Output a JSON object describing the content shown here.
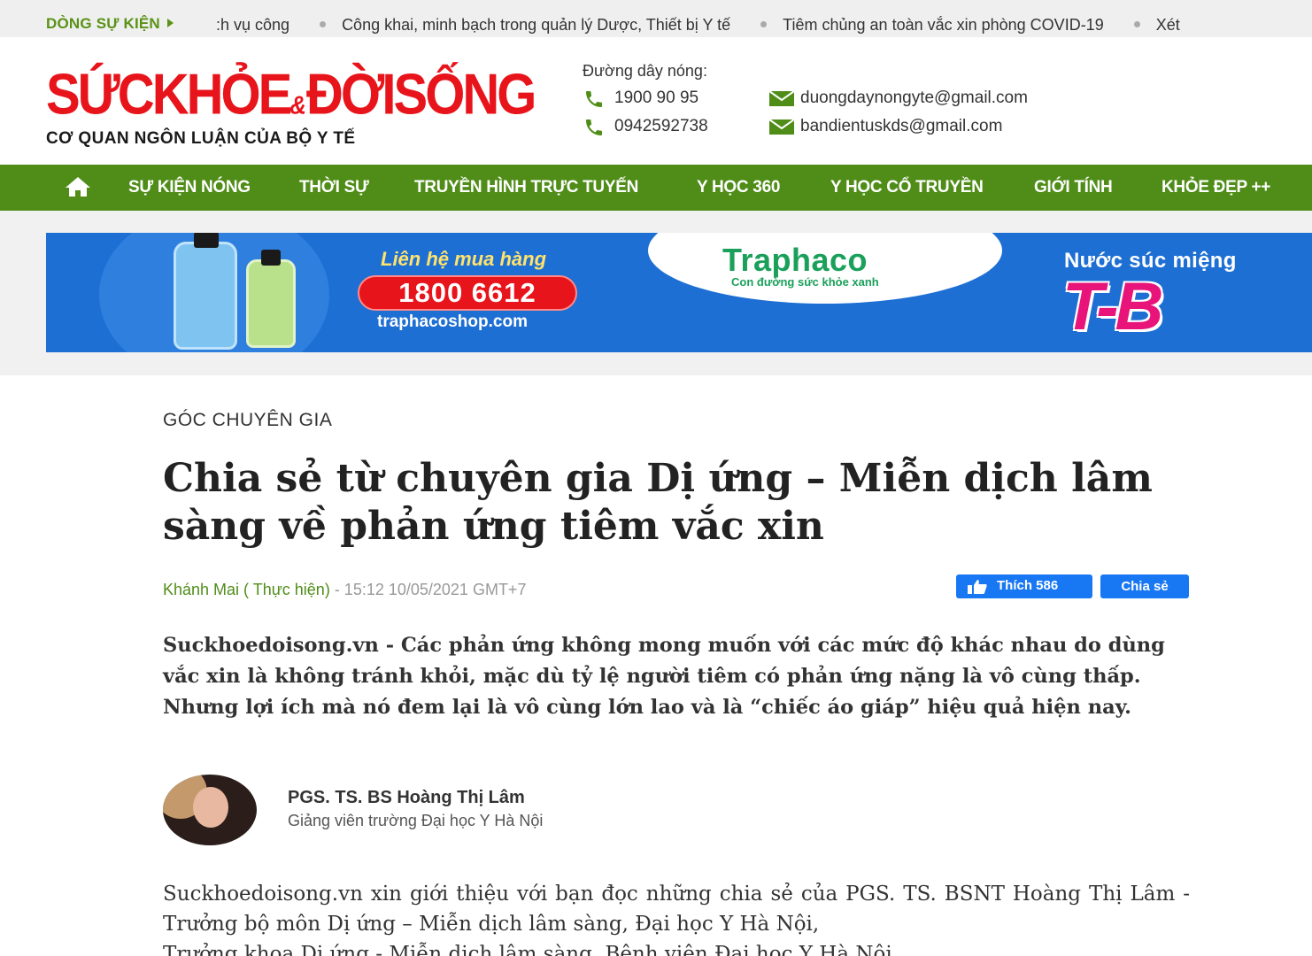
{
  "ticker": {
    "label": "DÒNG SỰ KIỆN",
    "items": [
      ":h vụ công",
      "Công khai, minh bạch trong quản lý Dược, Thiết bị Y tế",
      "Tiêm chủng an toàn vắc xin phòng COVID-19",
      "Xét"
    ]
  },
  "header": {
    "logo_main": "SỨCKHỎE",
    "logo_amp": "&",
    "logo_main2": "ĐỜISỐNG",
    "logo_sub": "CƠ QUAN NGÔN LUẬN CỦA BỘ Y TẾ",
    "hotline_title": "Đường dây nóng:",
    "phone1": "1900 90 95",
    "phone2": "0942592738",
    "email1": "duongdaynongyte@gmail.com",
    "email2": "bandientuskds@gmail.com"
  },
  "nav": {
    "home_icon": "home-icon",
    "items": [
      "SỰ KIỆN NÓNG",
      "THỜI SỰ",
      "TRUYỀN HÌNH TRỰC TUYẾN",
      "Y HỌC 360",
      "Y HỌC CỔ TRUYỀN",
      "GIỚI TÍNH",
      "KHỎE ĐẸP ++"
    ]
  },
  "banner": {
    "contact_label": "Liên hệ mua hàng",
    "phone": "1800 6612",
    "url": "traphacoshop.com",
    "brand": "Traphaco",
    "tagline": "Con đường sức khỏe xanh",
    "product": "Nước súc miệng",
    "product_logo": "T-B"
  },
  "article": {
    "category": "GÓC CHUYÊN GIA",
    "title": "Chia sẻ từ chuyên gia Dị ứng – Miễn dịch lâm sàng về phản ứng tiêm vắc xin",
    "author": "Khánh Mai ( Thực hiện)",
    "datetime": " - 15:12 10/05/2021 GMT+7",
    "like_label": "Thích 586",
    "share_label": "Chia sẻ",
    "sapo": "Suckhoedoisong.vn -  Các phản ứng không mong muốn với các mức độ khác nhau do dùng vắc xin là không tránh khỏi, mặc dù tỷ lệ người tiêm có phản ứng nặng là vô cùng thấp. Nhưng lợi ích mà nó đem lại là vô cùng lớn lao và là “chiếc áo giáp” hiệu quả hiện nay.",
    "expert_name": "PGS. TS. BS Hoàng Thị Lâm",
    "expert_role": "Giảng viên trường Đại học Y Hà Nội",
    "body": "Suckhoedoisong.vn xin giới thiệu với bạn đọc những chia sẻ của PGS. TS. BSNT Hoàng Thị Lâm - Trưởng bộ môn Dị ứng – Miễn dịch lâm sàng, Đại học Y Hà Nội,",
    "body_cut": "Trưởng khoa Dị ứng - Miễn dịch lâm sàng, Bệnh viện Đại học Y Hà Nội"
  },
  "colors": {
    "brand_red": "#e8141b",
    "nav_green": "#4f8d18",
    "facebook_blue": "#1877f2"
  }
}
